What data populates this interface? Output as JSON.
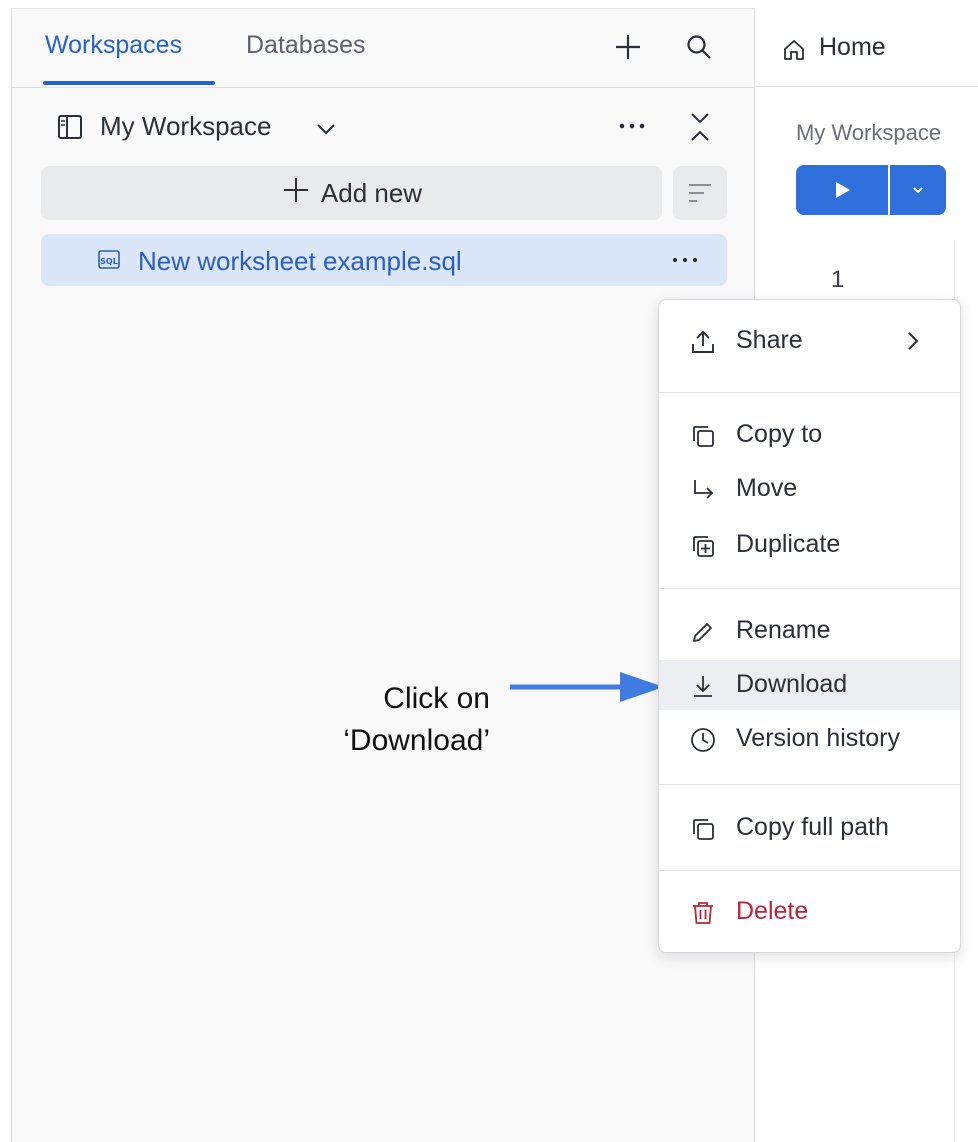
{
  "sidebar": {
    "tabs": [
      {
        "label": "Workspaces",
        "active": true
      },
      {
        "label": "Databases",
        "active": false
      }
    ],
    "workspace": {
      "name": "My Workspace"
    },
    "add_new_label": "Add new",
    "worksheets": [
      {
        "name": "New worksheet example.sql",
        "selected": true
      }
    ]
  },
  "main": {
    "tab_label": "Home",
    "breadcrumb": "My Workspace",
    "line_number": "1"
  },
  "context_menu": {
    "items": [
      {
        "label": "Share",
        "icon": "share-icon",
        "has_submenu": true
      },
      {
        "label": "Copy to",
        "icon": "copy-icon"
      },
      {
        "label": "Move",
        "icon": "move-arrow-icon"
      },
      {
        "label": "Duplicate",
        "icon": "duplicate-icon"
      },
      {
        "label": "Rename",
        "icon": "pencil-icon"
      },
      {
        "label": "Download",
        "icon": "download-icon",
        "highlighted": true
      },
      {
        "label": "Version history",
        "icon": "clock-icon"
      },
      {
        "label": "Copy full path",
        "icon": "copy-path-icon"
      },
      {
        "label": "Delete",
        "icon": "trash-icon",
        "danger": true
      }
    ]
  },
  "annotation": {
    "line1": "Click on",
    "line2": "‘Download’"
  },
  "colors": {
    "accent": "#2563c9",
    "run_button": "#2f6fdb",
    "selected_row": "#dbe6f8",
    "danger": "#b8283a",
    "annotation_arrow": "#3f7be0"
  }
}
